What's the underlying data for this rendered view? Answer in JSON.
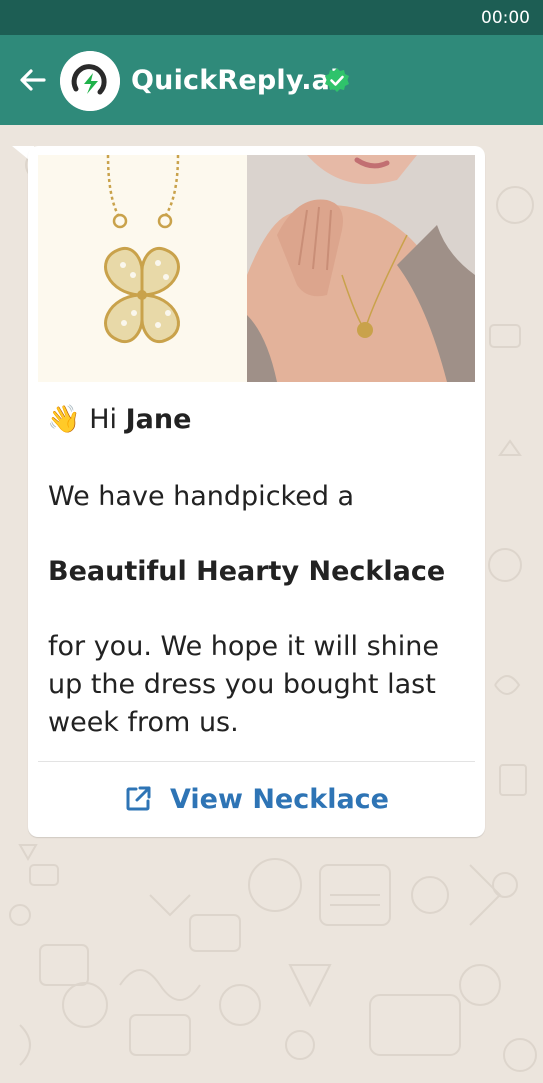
{
  "status_bar": {
    "time": "00:00"
  },
  "header": {
    "title": "QuickReply.ai",
    "back_icon": "arrow-left-icon",
    "verified_icon": "verified-check-icon"
  },
  "message": {
    "wave_emoji": "👋",
    "greeting_prefix": "Hi",
    "name": "Jane",
    "line1": "We have handpicked a",
    "product": "Beautiful Hearty Necklace",
    "line3a": "for you. We hope it will shine",
    "line3b": "up the dress you bought last",
    "line3c": "week from us.",
    "cta_label": "View Necklace",
    "cta_icon": "external-link-icon"
  },
  "colors": {
    "status_bar": "#1d5e54",
    "header": "#2f8a7a",
    "chat_bg": "#ece5dd",
    "link": "#2e74b5",
    "verified": "#2fc36b"
  }
}
